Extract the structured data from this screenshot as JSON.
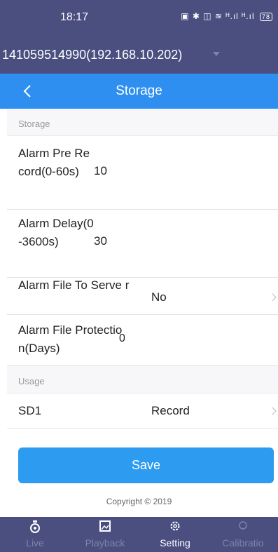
{
  "status_bar": {
    "time": "18:17",
    "icons": "▣ ✱ ◫ ≋ ᴴ.ıl ᴴ.ıl",
    "battery": "78"
  },
  "device": {
    "name": "141059514990(192.168.10.202)"
  },
  "nav": {
    "title": "Storage"
  },
  "sections": {
    "storage": "Storage",
    "usage": "Usage"
  },
  "rows": {
    "alarm_pre_record": {
      "label": "Alarm Pre Record(0-60s)",
      "value": "10"
    },
    "alarm_delay": {
      "label": "Alarm Delay(0-3600s)",
      "value": "30"
    },
    "alarm_file_to_server": {
      "label": "Alarm File To Serve r",
      "value": "No"
    },
    "alarm_file_protection": {
      "label": "Alarm File Protection(Days)",
      "value": "0"
    },
    "sd1": {
      "label": "SD1",
      "value": "Record"
    }
  },
  "save_label": "Save",
  "copyright": "Copyright © 2019",
  "tabs": [
    {
      "label": "Live",
      "icon": "live-icon",
      "active": false
    },
    {
      "label": "Playback",
      "icon": "playback-icon",
      "active": false
    },
    {
      "label": "Setting",
      "icon": "setting-icon",
      "active": true
    },
    {
      "label": "Calibratio",
      "icon": "calibration-icon",
      "active": false
    }
  ],
  "colors": {
    "header_bg": "#4a4f80",
    "nav_bg": "#2f8ff0",
    "save_bg": "#2d9bf0",
    "inactive_tab": "#7d82a8"
  }
}
